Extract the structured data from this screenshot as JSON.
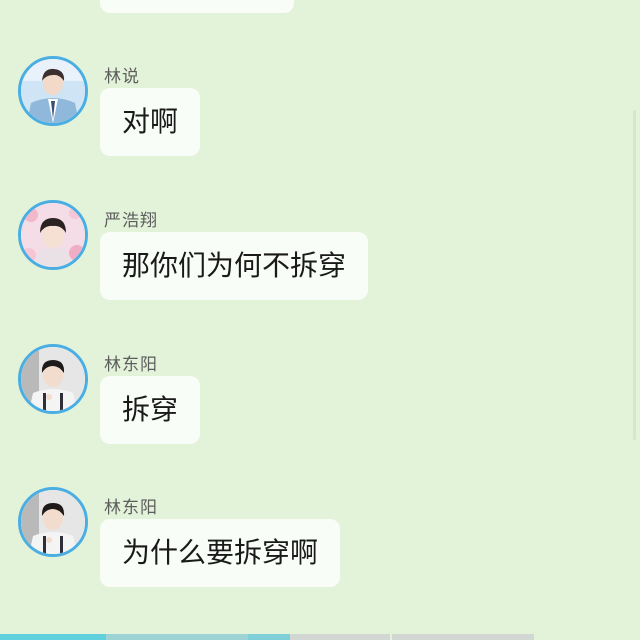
{
  "messages": [
    {
      "sender": "林说",
      "text": "对啊",
      "avatar": "avatar-schoolboy-blue-cardigan"
    },
    {
      "sender": "严浩翔",
      "text": "那你们为何不拆穿",
      "avatar": "avatar-boy-flower-background"
    },
    {
      "sender": "林东阳",
      "text": "拆穿",
      "avatar": "avatar-boy-suspenders"
    },
    {
      "sender": "林东阳",
      "text": "为什么要拆穿啊",
      "avatar": "avatar-boy-suspenders"
    }
  ],
  "colors": {
    "background": "#e3f3da",
    "bubble": "#f9fdf7",
    "avatar_ring": "#4aaee3",
    "sender_text": "#5d5d5d",
    "message_text": "#1a1a1a"
  }
}
